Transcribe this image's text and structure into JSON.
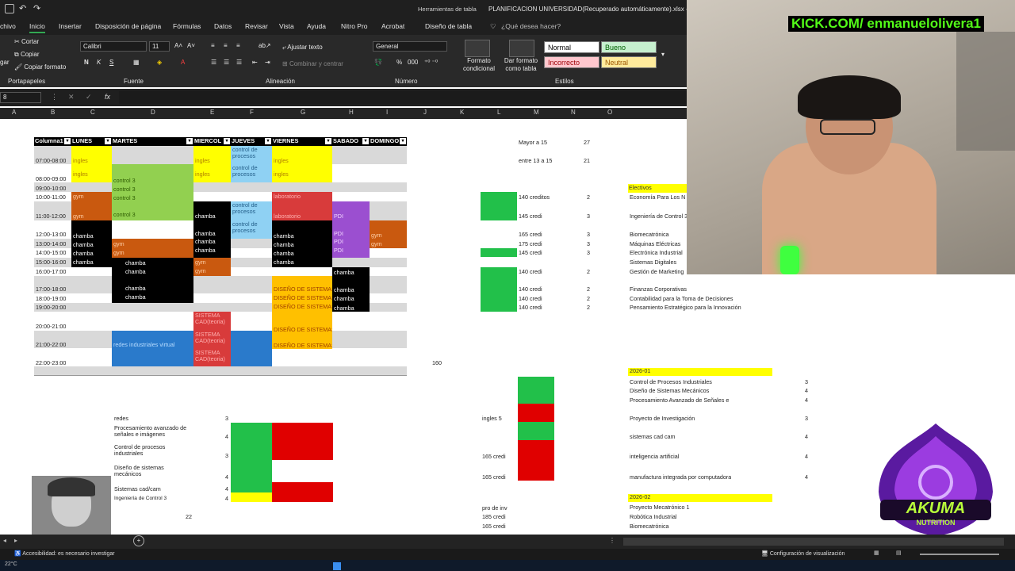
{
  "window": {
    "title": "PLANIFICACION UNIVERSIDAD(Recuperado automáticamente).xlsx -",
    "context_label": "Herramientas de tabla"
  },
  "ribbon": {
    "tabs": [
      "chivo",
      "Inicio",
      "Insertar",
      "Disposición de página",
      "Fórmulas",
      "Datos",
      "Revisar",
      "Vista",
      "Ayuda",
      "Nitro Pro",
      "Acrobat",
      "Diseño de tabla"
    ],
    "active_tab": "Inicio",
    "search_placeholder": "¿Qué desea hacer?",
    "clipboard": {
      "cut": "Cortar",
      "copy": "Copiar",
      "format_painter": "Copiar formato",
      "paste": "gar",
      "group": "Portapapeles"
    },
    "font": {
      "name": "Calibri",
      "size": "11",
      "bold": "N",
      "italic": "K",
      "underline": "S",
      "group": "Fuente"
    },
    "alignment": {
      "wrap": "Ajustar texto",
      "merge": "Combinar y centrar",
      "group": "Alineación"
    },
    "number": {
      "format": "General",
      "percent": "%",
      "thousands": "000",
      "group": "Número"
    },
    "styles": {
      "conditional": "Formato condicional",
      "as_table": "Dar formato como tabla",
      "normal": "Normal",
      "good": "Bueno",
      "bad": "Incorrecto",
      "neutral": "Neutral",
      "group": "Estilos"
    }
  },
  "formula_bar": {
    "name_box": "8",
    "fx": "fx",
    "value": ""
  },
  "columns": [
    "A",
    "B",
    "C",
    "D",
    "E",
    "F",
    "G",
    "H",
    "I",
    "J",
    "K",
    "L",
    "M",
    "N",
    "O"
  ],
  "schedule": {
    "headers": [
      "Columna1",
      "LUNES",
      "MARTES",
      "MIERCOL",
      "JUEVES",
      "VIERNES",
      "SABADO",
      "DOMINGO"
    ],
    "times": [
      "07:00-08:00",
      "08:00-09:00",
      "09:00-10:00",
      "10:00-11:00",
      "11:00-12:00",
      "12:00-13:00",
      "13:00-14:00",
      "14:00-15:00",
      "15:00-16:00",
      "16:00-17:00",
      "17:00-18:00",
      "18:00-19:00",
      "19:00-20:00",
      "20:00-21:00",
      "21:00-22:00",
      "22:00-23:00"
    ],
    "cells": {
      "ingles": "ingles",
      "control3": "control 3",
      "control_procesos": "control de procesos",
      "gym": "gym",
      "laboratorio": "laboratorio",
      "chamba": "chamba",
      "pdi": "PDI",
      "diseno": "DISEÑO DE SISTEMAS",
      "sistema_cad": "SISTEMA CAD(teoria)",
      "redes_virtual": "redes industriales virtual"
    },
    "total": "160"
  },
  "stats": {
    "mayor15_label": "Mayor a 15",
    "mayor15_value": "27",
    "entre_label": "entre 13 a 15",
    "entre_value": "21"
  },
  "credits_list": [
    {
      "label": "140 creditos",
      "n": "2"
    },
    {
      "label": "145 credi",
      "n": "3"
    },
    {
      "label": "165 credi",
      "n": "3"
    },
    {
      "label": "175 credi",
      "n": "3"
    },
    {
      "label": "145 credi",
      "n": "3"
    },
    {
      "label": "140 credi",
      "n": "2"
    },
    {
      "label": "140 credi",
      "n": "2"
    },
    {
      "label": "140 credi",
      "n": "2"
    },
    {
      "label": "140 credi",
      "n": "2"
    }
  ],
  "electivos": {
    "header": "Electivos",
    "items": [
      "Economía Para Los N",
      "Ingeniería de Control 3",
      "Biomecatrónica",
      "Máquinas Eléctricas",
      "Electrónica Industrial",
      "Sistemas Digitales",
      "Gestión de Marketing",
      "Finanzas Corporativas",
      "Contabilidad para la Toma de Decisiones",
      "Pensamiento Estratégico para la Innovación"
    ]
  },
  "subjects": [
    {
      "name": "redes",
      "n": "3"
    },
    {
      "name": "Procesamiento avanzado de señales e imágenes",
      "n": "4"
    },
    {
      "name": "Control de procesos industriales",
      "n": "3"
    },
    {
      "name": "Diseño de sistemas mecánicos",
      "n": "4"
    },
    {
      "name": "Sistemas cad/cam",
      "n": "4"
    },
    {
      "name": "Ingeniería de Control 3",
      "n": "4"
    }
  ],
  "subjects_total": "22",
  "side_notes": [
    "ingles 5",
    "165 credi",
    "165 credi",
    "pro de inv",
    "185 credi",
    "165 credi"
  ],
  "semester_2026_01": {
    "header": "2026-01",
    "items": [
      {
        "name": "Control de Procesos Industriales",
        "n": "3"
      },
      {
        "name": "Diseño de Sistemas Mecánicos",
        "n": "4"
      },
      {
        "name": "Procesamiento Avanzado de Señales e",
        "n": "4"
      },
      {
        "name": "Proyecto de Investigación",
        "n": "3"
      },
      {
        "name": "sistemas cad cam",
        "n": "4"
      },
      {
        "name": "inteligencia artificial",
        "n": "4"
      },
      {
        "name": "manufactura integrada por computadora",
        "n": "4"
      }
    ]
  },
  "semester_2026_02": {
    "header": "2026-02",
    "items": [
      "Proyecto Mecatrónico 1",
      "Robótica Industrial",
      "Biomecatrónica"
    ]
  },
  "overlay": {
    "stream_url": "KICK.COM/ enmanuelolivera1",
    "brand": "AKUMA",
    "brand_sub": "NUTRITION"
  },
  "statusbar": {
    "accessibility": "Accesibilidad: es necesario investigar",
    "display_settings": "Configuración de visualización"
  },
  "taskbar": {
    "temp": "22°C"
  }
}
